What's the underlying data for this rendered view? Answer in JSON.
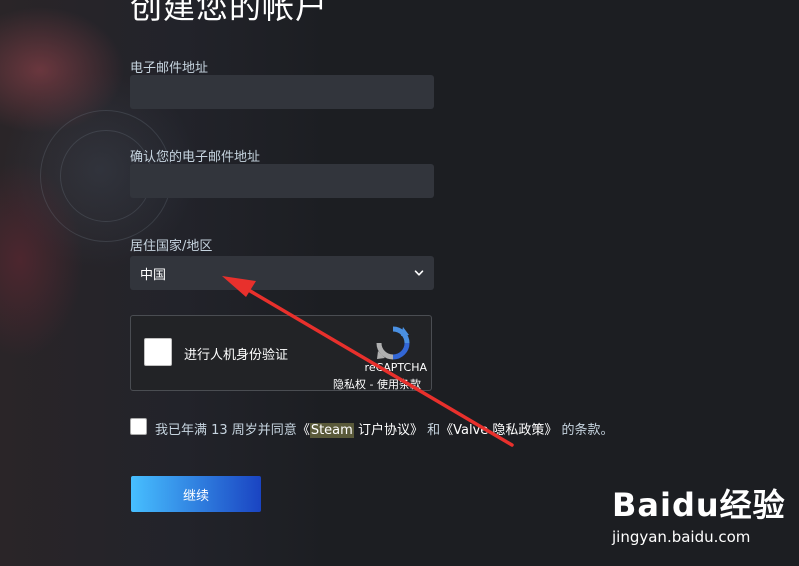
{
  "page": {
    "title": "创建您的帐户"
  },
  "form": {
    "email_label": "电子邮件地址",
    "email_value": "",
    "confirm_email_label": "确认您的电子邮件地址",
    "confirm_email_value": "",
    "country_label": "居住国家/地区",
    "country_value": "中国"
  },
  "captcha": {
    "label": "进行人机身份验证",
    "brand": "reCAPTCHA",
    "privacy_link": "隐私权",
    "separator": " - ",
    "terms_link": "使用条款"
  },
  "agreement": {
    "prefix": "我已年满 13 周岁并同意",
    "open1": "《",
    "steam": "Steam",
    "ssa": " 订户协议》",
    "and": "和",
    "valve_policy": "《Valve 隐私政策》",
    "suffix": "的条款。",
    "checked": false
  },
  "actions": {
    "continue_label": "继续"
  },
  "watermark": {
    "brand": "Baidu经验",
    "url": "jingyan.baidu.com"
  },
  "colors": {
    "background": "#1c1e22",
    "input_bg": "#32353c",
    "button_start": "#47bfff",
    "button_end": "#1a44c2",
    "annotation_arrow": "#e8302c"
  },
  "icons": {
    "select_chevron": "chevron-down-icon",
    "captcha_logo": "recaptcha-logo-icon",
    "annotation": "red-arrow-icon"
  }
}
